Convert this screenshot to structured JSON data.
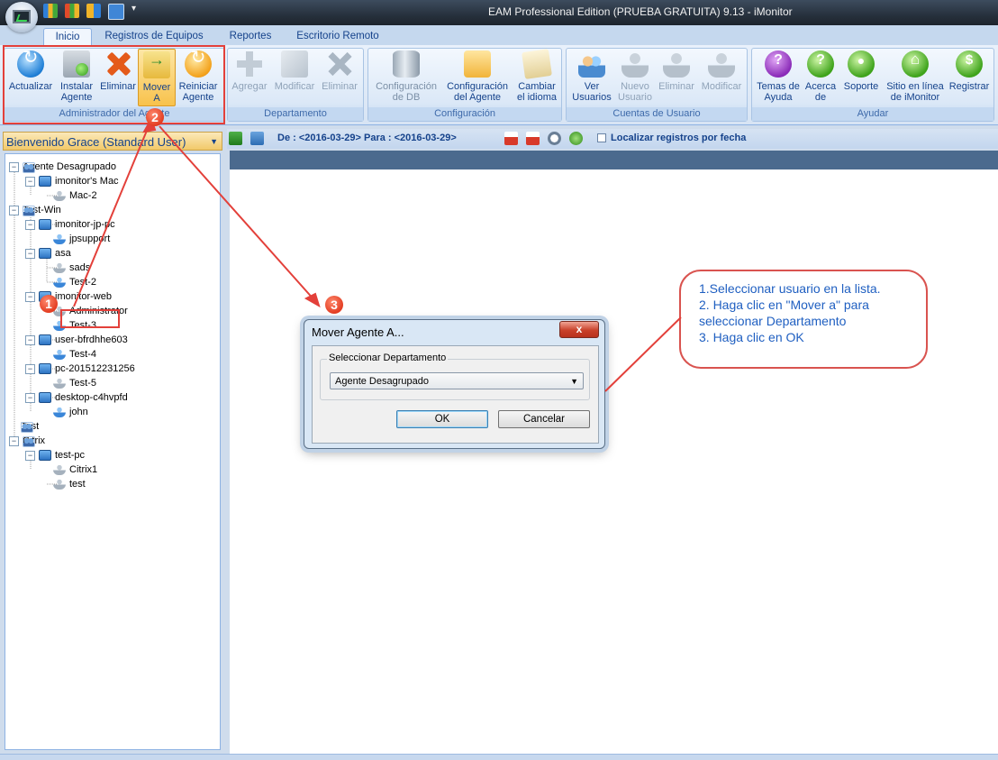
{
  "window": {
    "title": "EAM Professional Edition (PRUEBA GRATUITA) 9.13 - iMonitor"
  },
  "tabs": [
    {
      "label": "Inicio"
    },
    {
      "label": "Registros de Equipos"
    },
    {
      "label": "Reportes"
    },
    {
      "label": "Escritorio Remoto"
    }
  ],
  "ribbon": {
    "groups": [
      {
        "label": "Administrador del Agente",
        "buttons": [
          {
            "line1": "Actualizar",
            "line2": "",
            "icon": "refresh-icon"
          },
          {
            "line1": "Instalar",
            "line2": "Agente",
            "icon": "install-agent-icon"
          },
          {
            "line1": "Eliminar",
            "line2": "",
            "icon": "delete-icon"
          },
          {
            "line1": "Mover",
            "line2": "A",
            "icon": "move-folder-icon"
          },
          {
            "line1": "Reiniciar",
            "line2": "Agente",
            "icon": "restart-icon"
          }
        ]
      },
      {
        "label": "Departamento",
        "buttons": [
          {
            "line1": "Agregar",
            "line2": "",
            "icon": "add-icon"
          },
          {
            "line1": "Modificar",
            "line2": "",
            "icon": "edit-icon"
          },
          {
            "line1": "Eliminar",
            "line2": "",
            "icon": "delete-icon"
          }
        ]
      },
      {
        "label": "Configuración",
        "buttons": [
          {
            "line1": "Configuración",
            "line2": "de DB",
            "icon": "database-icon"
          },
          {
            "line1": "Configuración",
            "line2": "del Agente",
            "icon": "agent-config-icon"
          },
          {
            "line1": "Cambiar",
            "line2": "el idioma",
            "icon": "language-icon"
          }
        ]
      },
      {
        "label": "Cuentas de Usuario",
        "buttons": [
          {
            "line1": "Ver",
            "line2": "Usuarios",
            "icon": "users-icon"
          },
          {
            "line1": "Nuevo",
            "line2": "Usuario",
            "icon": "new-user-icon"
          },
          {
            "line1": "Eliminar",
            "line2": "",
            "icon": "delete-user-icon"
          },
          {
            "line1": "Modificar",
            "line2": "",
            "icon": "edit-user-icon"
          }
        ]
      },
      {
        "label": "Ayudar",
        "buttons": [
          {
            "line1": "Temas de",
            "line2": "Ayuda",
            "icon": "help-icon"
          },
          {
            "line1": "Acerca",
            "line2": "de",
            "icon": "about-icon"
          },
          {
            "line1": "Soporte",
            "line2": "",
            "icon": "support-icon"
          },
          {
            "line1": "Sitio en línea",
            "line2": "de iMonitor",
            "icon": "home-icon"
          },
          {
            "line1": "Registrar",
            "line2": "",
            "icon": "register-icon"
          }
        ]
      }
    ]
  },
  "sidebar": {
    "header": "Bienvenido Grace (Standard User)",
    "tree": [
      {
        "label": "Agente Desagrupado",
        "icon": "group"
      },
      {
        "label": "imonitor's Mac",
        "icon": "pc"
      },
      {
        "label": "Mac-2",
        "icon": "user-gray"
      },
      {
        "label": "Test-Win",
        "icon": "group"
      },
      {
        "label": "imonitor-jp-pc",
        "icon": "pc"
      },
      {
        "label": "jpsupport",
        "icon": "user"
      },
      {
        "label": "asa",
        "icon": "pc"
      },
      {
        "label": "sads",
        "icon": "user-gray"
      },
      {
        "label": "Test-2",
        "icon": "user"
      },
      {
        "label": "imonitor-web",
        "icon": "pc"
      },
      {
        "label": "Administrator",
        "icon": "user-gray"
      },
      {
        "label": "Test-3",
        "icon": "user"
      },
      {
        "label": "user-bfrdhhe603",
        "icon": "pc"
      },
      {
        "label": "Test-4",
        "icon": "user"
      },
      {
        "label": "pc-201512231256",
        "icon": "pc"
      },
      {
        "label": "Test-5",
        "icon": "user-gray"
      },
      {
        "label": "desktop-c4hvpfd",
        "icon": "pc"
      },
      {
        "label": "john",
        "icon": "user"
      },
      {
        "label": "Test",
        "icon": "group"
      },
      {
        "label": "Citrix",
        "icon": "group"
      },
      {
        "label": "test-pc",
        "icon": "pc"
      },
      {
        "label": "Citrix1",
        "icon": "user-gray"
      },
      {
        "label": "test",
        "icon": "user-gray"
      }
    ]
  },
  "toolbar": {
    "date_range": "De : <2016-03-29> Para : <2016-03-29>",
    "locate_label": "Localizar registros por fecha"
  },
  "dialog": {
    "title": "Mover Agente A...",
    "close": "x",
    "group_label": "Seleccionar Departamento",
    "selected": "Agente Desagrupado",
    "ok": "OK",
    "cancel": "Cancelar"
  },
  "annotation": {
    "lines": [
      "1.Seleccionar usuario en la lista.",
      "2. Haga clic en \"Mover a\" para",
      "seleccionar Departamento",
      "3. Haga clic en OK"
    ],
    "markers": [
      "1",
      "2",
      "3"
    ],
    "color": "#e3403a"
  }
}
